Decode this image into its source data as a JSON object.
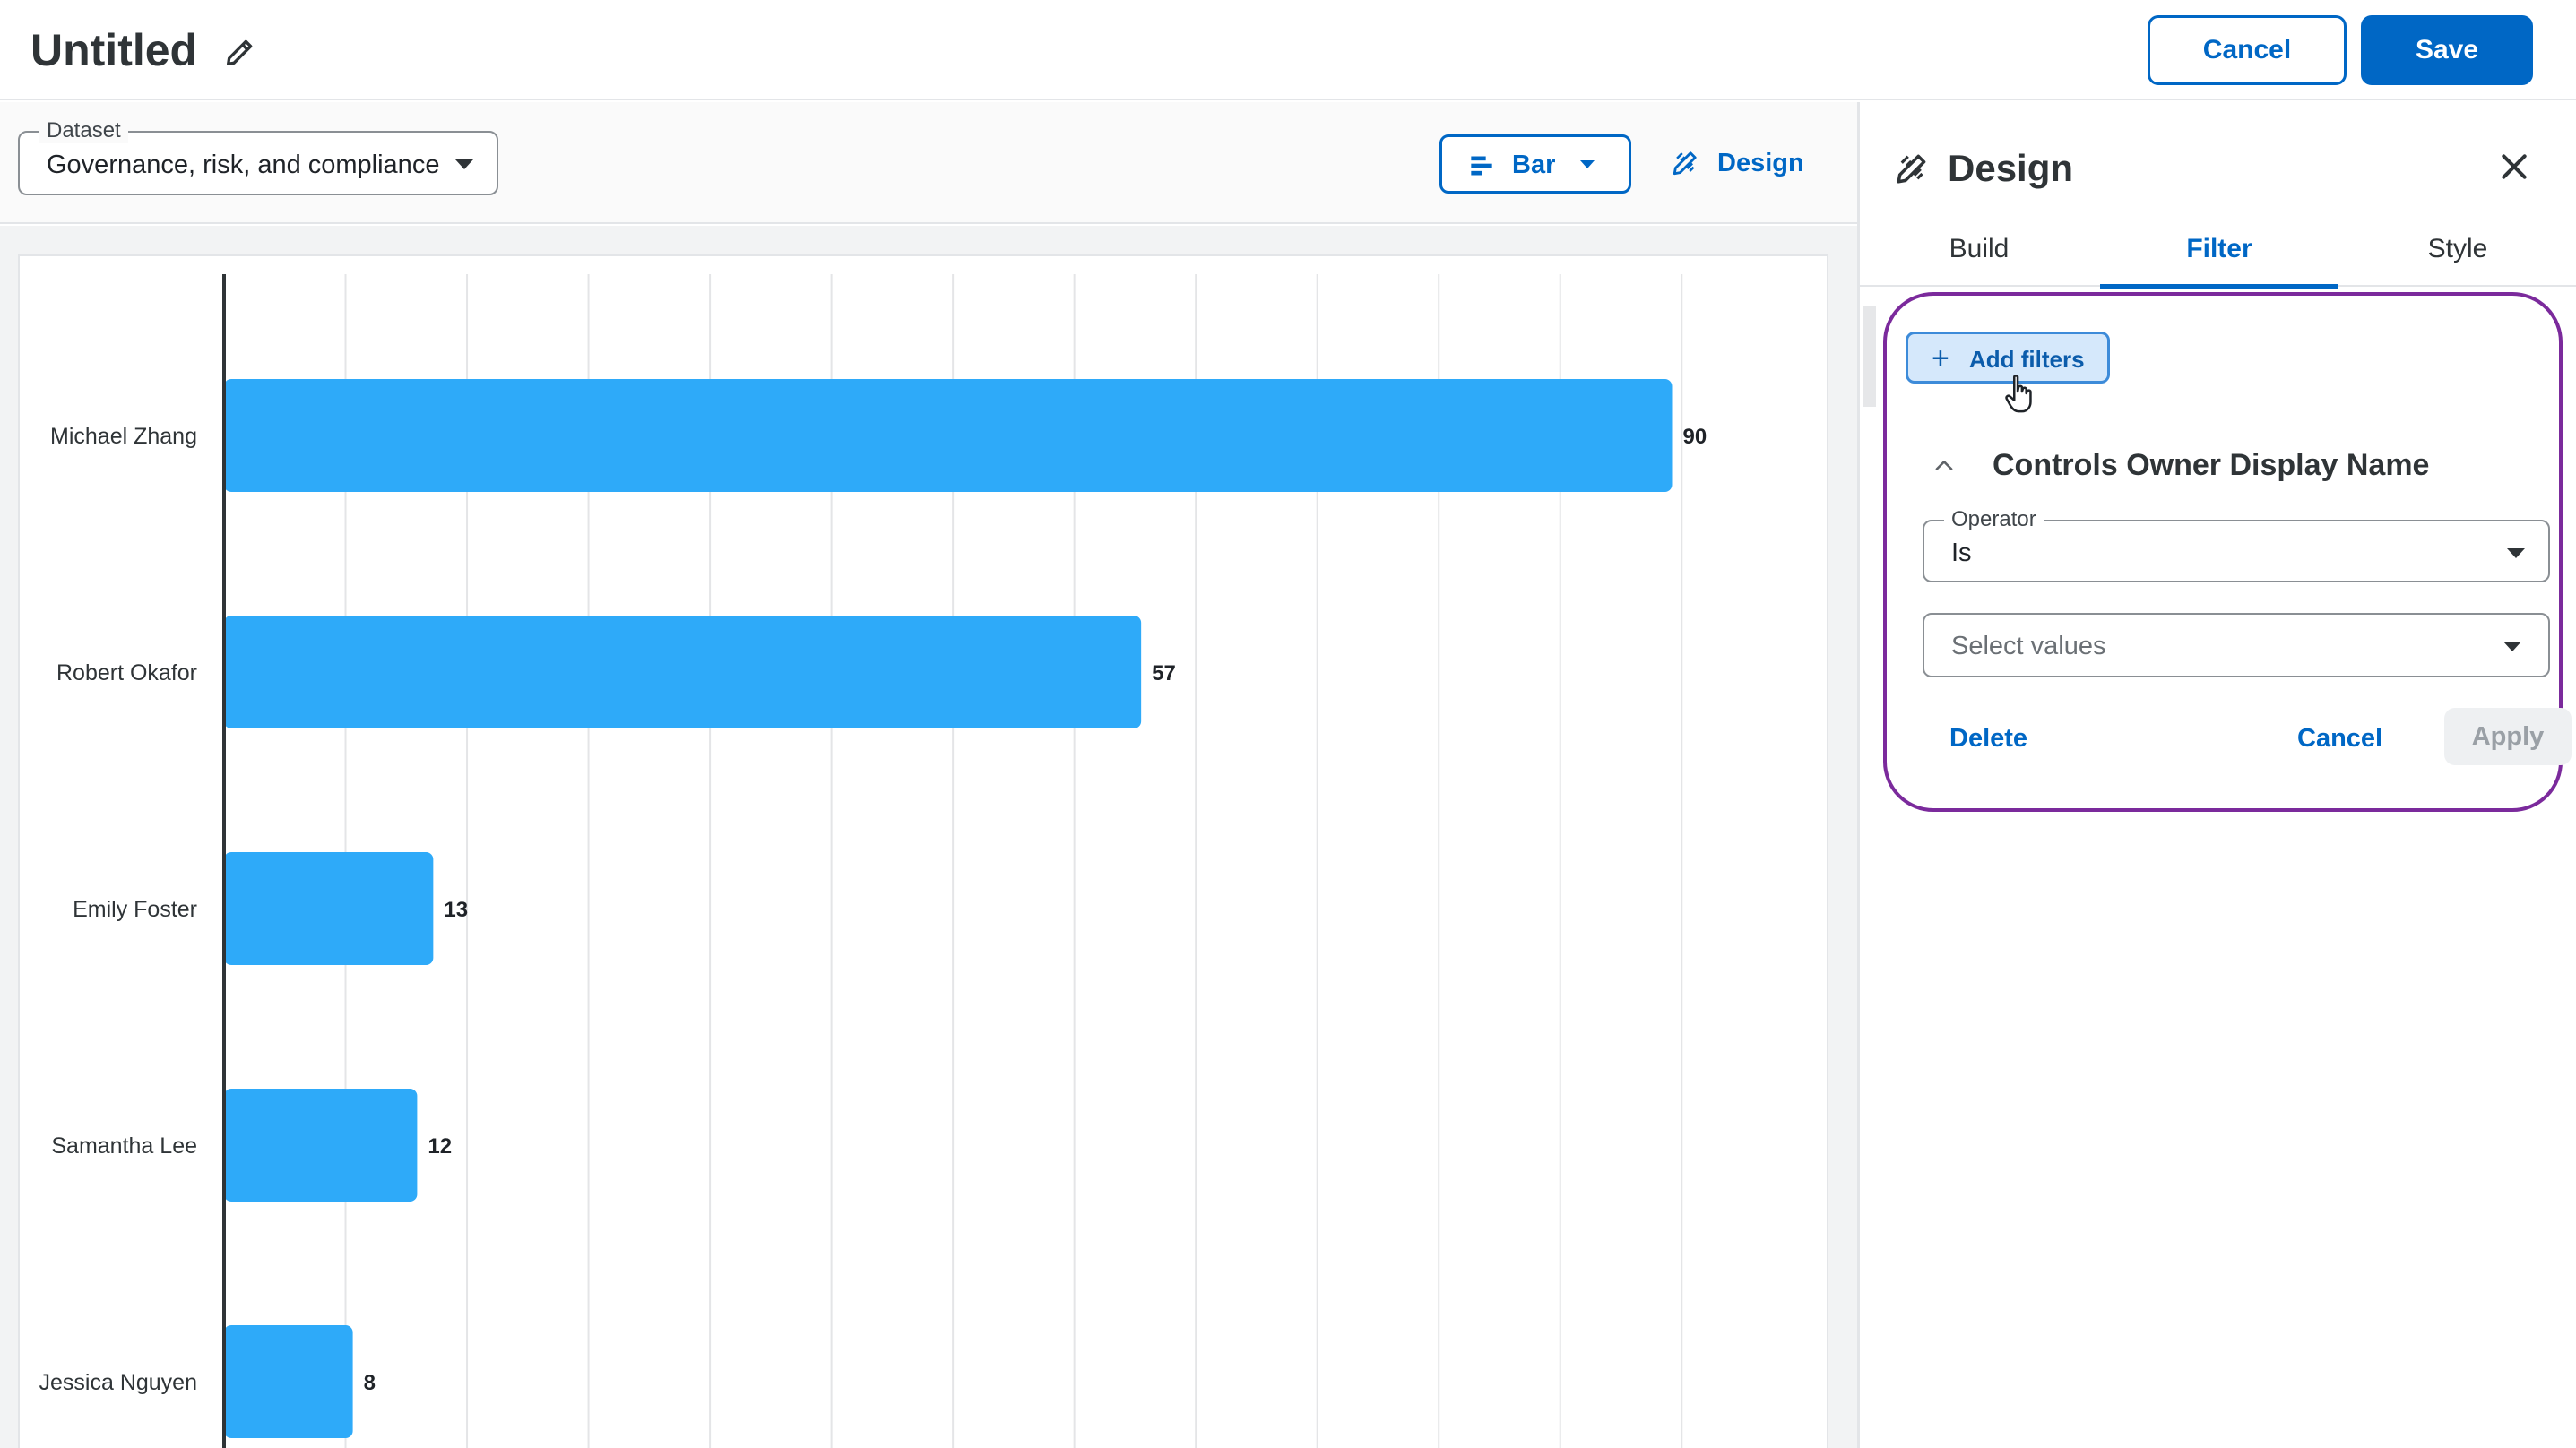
{
  "header": {
    "title": "Untitled",
    "cancel_label": "Cancel",
    "save_label": "Save"
  },
  "toolbar": {
    "dataset_label": "Dataset",
    "dataset_value": "Governance, risk, and compliance",
    "chart_type_label": "Bar",
    "design_label": "Design"
  },
  "colors": {
    "accent": "#0067c5",
    "bar": "#2eaaf9",
    "filter_outline": "#7b2a9c"
  },
  "icons": {
    "title_edit": "pencil-icon",
    "bar_type": "horizontal-bar-chart-icon",
    "design": "design-pencil-ruler-icon",
    "close": "close-icon",
    "add": "plus-icon",
    "collapse": "chevron-up-icon",
    "cursor": "hand-pointer-cursor-icon"
  },
  "panel": {
    "title": "Design",
    "tabs": [
      {
        "label": "Build",
        "active": false
      },
      {
        "label": "Filter",
        "active": true
      },
      {
        "label": "Style",
        "active": false
      }
    ],
    "add_filters_label": "Add filters",
    "filter": {
      "heading": "Controls Owner Display Name",
      "operator_label": "Operator",
      "operator_value": "Is",
      "values_placeholder": "Select values",
      "delete_label": "Delete",
      "cancel_label": "Cancel",
      "apply_label": "Apply"
    }
  },
  "chart_data": {
    "type": "bar",
    "orientation": "horizontal",
    "categories": [
      "Michael Zhang",
      "Robert Okafor",
      "Emily Foster",
      "Samantha Lee",
      "Jessica Nguyen"
    ],
    "values": [
      90,
      57,
      13,
      12,
      8
    ],
    "xlim": [
      0,
      98
    ],
    "grid": true,
    "data_labels": true
  }
}
